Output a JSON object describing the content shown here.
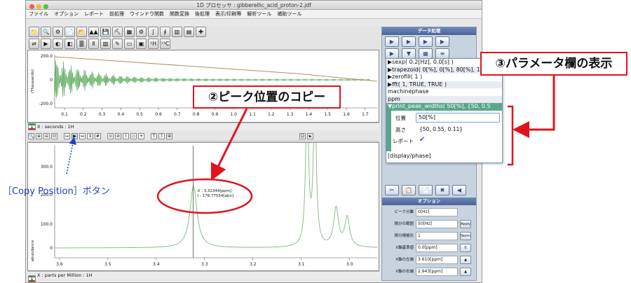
{
  "window": {
    "title": "1D プロセッサ : gibberellic_acid_proton-2.jdf"
  },
  "menu": [
    "ファイル",
    "オプション",
    "レポート",
    "前処理",
    "ウインドウ関数",
    "関数変換",
    "後処理",
    "表示/印刷等",
    "解析ツール",
    "補助ツール"
  ],
  "toolbar1": [
    "📁",
    "🔍",
    "⚙",
    "📄",
    "📂",
    "▲▲",
    "💾",
    "⛏",
    "▦",
    "⚙",
    "∫",
    "∮",
    "▥",
    "▤",
    "✚"
  ],
  "toolbar2": [
    "⇌",
    "▶",
    "◐",
    "◧",
    "▒",
    "Ⅱ",
    "▧",
    "✎",
    "▭",
    "▣",
    "¹H",
    "¹³C"
  ],
  "fid_chart": {
    "ylabel": "(Thousands)",
    "yticks": [
      "200.0",
      "0",
      "-200.0"
    ],
    "xticks": [
      "0.1",
      "0.2",
      "0.3",
      "0.4",
      "0.5",
      "0.6",
      "0.7",
      "0.8",
      "0.9",
      "1.0",
      "1.1",
      "1.2",
      "1.3",
      "1.4",
      "1.5",
      "1.6",
      "1.7"
    ],
    "status": "X : seconds : 1H",
    "flag": "1"
  },
  "spectrum_chart": {
    "ylabel": "abundance",
    "yticks": [
      "300.0",
      "200.0",
      "100.0",
      "0"
    ],
    "xticks": [
      "3.6",
      "3.5",
      "3.4",
      "3.3",
      "3.2",
      "3.1",
      "3.0"
    ],
    "status": "X : parts per Million : 1H",
    "flag": "1",
    "cursor_x": "X : 3.32344[ppm]",
    "cursor_y": "I : 178.77554[abn]"
  },
  "spectrum_tools": [
    "🔍",
    "⊕",
    "⊖",
    "⊡",
    "↦",
    "▶",
    "↔",
    "⇕",
    "#",
    "⊙",
    "⊘",
    "⌇",
    "◇",
    "+",
    "T",
    "Ξ",
    "⊞",
    "☺",
    "☯"
  ],
  "right_panel": {
    "header": "データ処理",
    "nav_buttons": [
      "▶",
      "▶",
      "▶",
      "▶"
    ],
    "nav_buttons2": [
      "▶",
      "▼",
      "▦",
      "≡"
    ],
    "options_title": "オプション",
    "tool_buttons": [
      "✂",
      "📋",
      "📄",
      "✖",
      "◀"
    ],
    "options": [
      {
        "label": "ピーク分離",
        "value": "0[Hz]",
        "button": ""
      },
      {
        "label": "積分の範囲",
        "value": "50[Hz]",
        "button": "Apply"
      },
      {
        "label": "積分規格化",
        "value": "1",
        "button": "Norm"
      },
      {
        "label": "X軸基準値",
        "value": "0.0[ppm]",
        "button": "0"
      },
      {
        "label": "X軸の左端",
        "value": "3.610[ppm]",
        "button": "▲"
      },
      {
        "label": "X軸の右端",
        "value": "2.943[ppm]",
        "button": "▲"
      }
    ]
  },
  "popup": {
    "lines": [
      "▶sexp( 0.2[Hz], 0.0[s] )",
      "▶trapezoid( 0[%], 0[%], 80[%], 1",
      "▶zerofill( 1 )",
      "▶fft( 1, TRUE, TRUE )",
      "machinephase",
      "ppm",
      "▼print_peak_widths( 50[%], {50, 0.5"
    ],
    "param_label_pos": "位置",
    "param_value_pos": "50[%]",
    "param_label_height": "高さ",
    "param_value_height": "{50, 0.55, 0.11}",
    "param_label_report": "レポート",
    "param_check": "✔",
    "footer": "[display/phase]"
  },
  "annotations": {
    "peak_copy": "②ピーク位置のコピー",
    "param_display": "③パラメータ欄の表示",
    "copy_button": "［Copy Position］ボタン"
  },
  "colors": {
    "trace": "#3b9a3b",
    "spectrum": "#7db87d",
    "annotation": "#e0141e",
    "blue_label": "#1f3fc0"
  }
}
